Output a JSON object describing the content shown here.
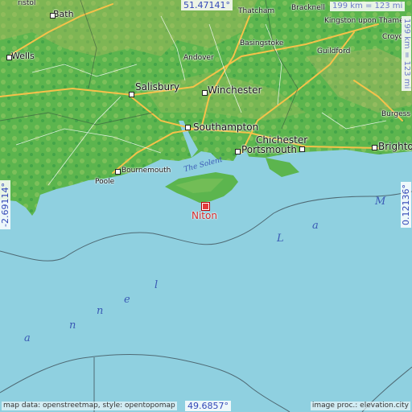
{
  "map": {
    "colors": {
      "sea": "#8fd0e0",
      "land_low": "#4fb24a",
      "land_mid": "#7cc05a",
      "land_high": "#b8b866",
      "road_major": "#f5c24a",
      "road_minor": "#ffffff",
      "target": "#d62b2b",
      "coord": "#3348b8"
    },
    "places": {
      "bath": "Bath",
      "wells": "Wells",
      "andover": "Andover",
      "basingstoke": "Basingstoke",
      "bracknell": "Bracknell",
      "kingston": "Kingston upon Thames",
      "croydon": "Croyd",
      "guildford": "Guildford",
      "salisbury": "Salisbury",
      "winchester": "Winchester",
      "southampton": "Southampton",
      "chichester": "Chichester",
      "portsmouth": "Portsmouth",
      "bournemouth": "Bournemouth",
      "poole": "Poole",
      "burgess_hill": "Burgess H",
      "brighton": "Brighton",
      "thatcham": "Thatcham",
      "bristol": "ristol"
    },
    "water": {
      "solent": "The Solent",
      "channel_letters": [
        "a",
        "n",
        "n",
        "e",
        "l",
        "L",
        "a",
        "M"
      ]
    },
    "target": {
      "name": "Niton",
      "icon": "square-marker-icon"
    },
    "coords": {
      "top": "51.47141°",
      "bottom": "49.6857°",
      "left": "-2.69114°",
      "right": "0.12136°"
    },
    "scale": {
      "horizontal": "199 km = 123 mi",
      "vertical": "199 km = 123 mi"
    },
    "credits": {
      "left": "map data: openstreetmap, style: opentopomap",
      "right": "image proc.: elevation.city"
    }
  }
}
